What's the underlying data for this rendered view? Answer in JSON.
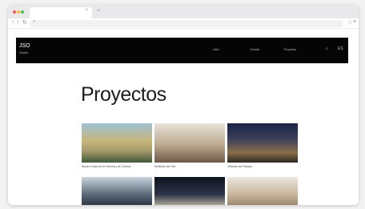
{
  "browser": {
    "tab_close": "×",
    "new_tab": "+",
    "nav_back": "‹",
    "nav_forward": "›",
    "nav_reload": "↻",
    "url_icon": "⌕",
    "bookmark": "☆",
    "menu": "≡"
  },
  "site": {
    "logo": "JSO",
    "logo_sub": "Studio",
    "nav": [
      "Inicio",
      "Estudio",
      "Proyectos"
    ],
    "search_icon": "⌕",
    "lang_icon": "ES"
  },
  "main": {
    "title": "Proyectos",
    "projects": [
      {
        "caption": "Museo Casa de la Ciencia y la Cultura"
      },
      {
        "caption": "Auditorio del Sur"
      },
      {
        "caption": "Oficinas del Parque"
      },
      {
        "caption": ""
      },
      {
        "caption": ""
      },
      {
        "caption": ""
      }
    ]
  }
}
